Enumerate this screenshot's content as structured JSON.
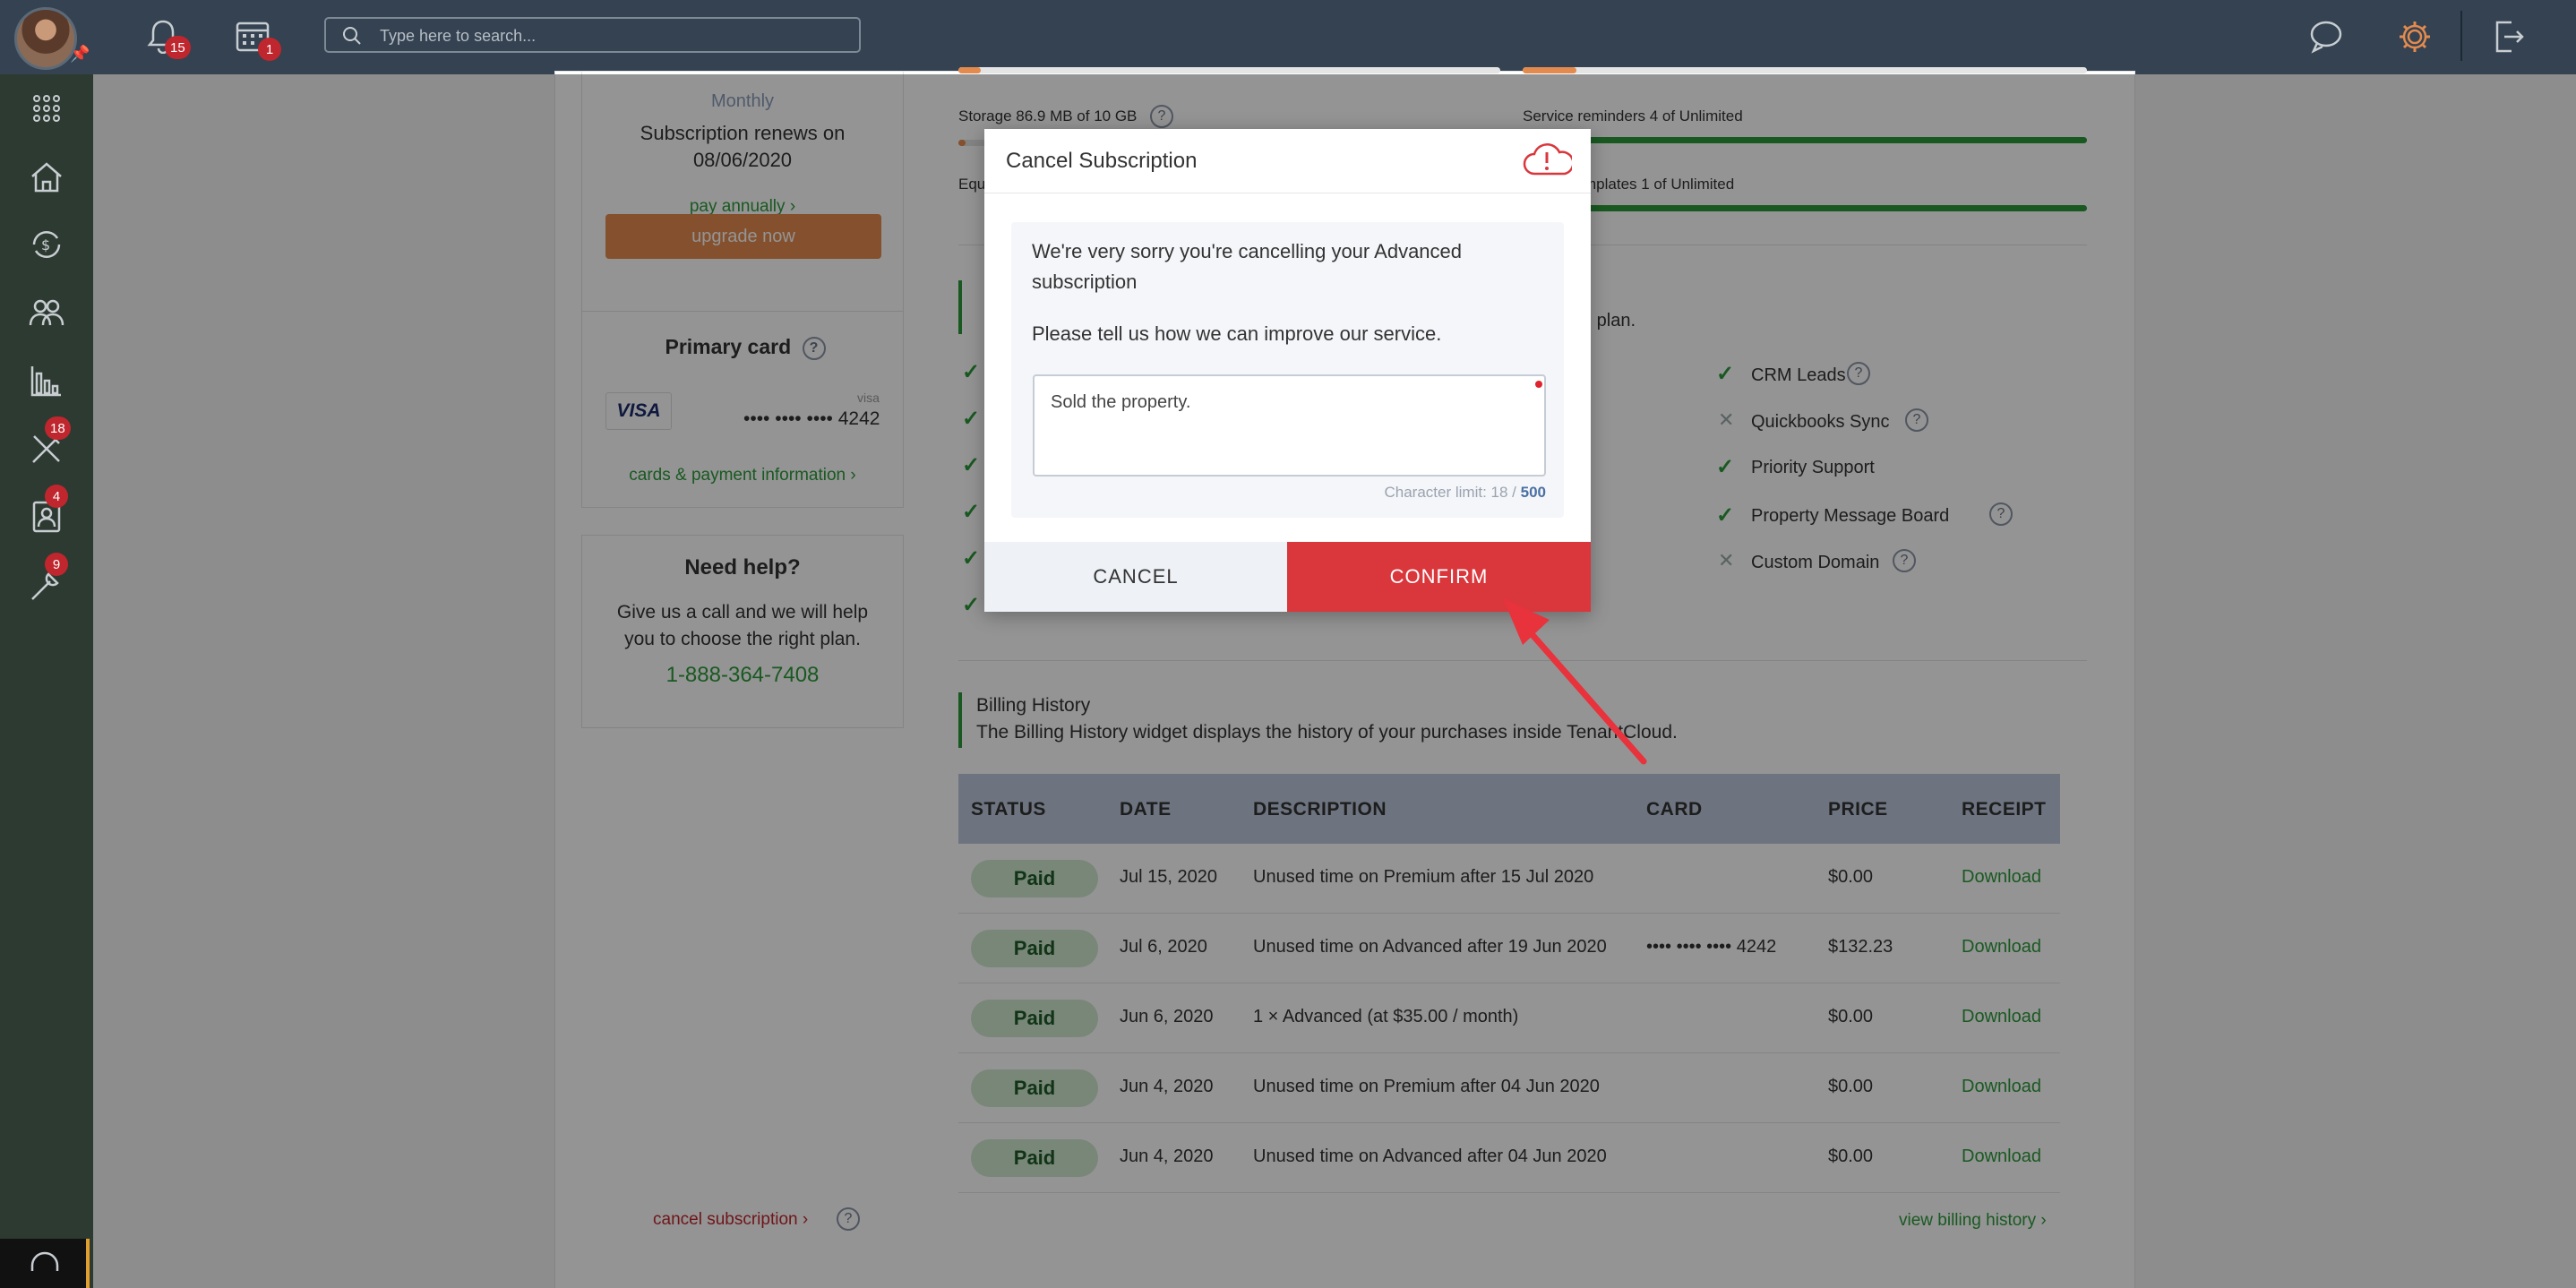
{
  "topbar": {
    "notifications_count": "15",
    "calendar_count": "1",
    "search_placeholder": "Type here to search..."
  },
  "sidebar": {
    "items": [
      {
        "icon": "apps-grid-icon"
      },
      {
        "icon": "properties-icon"
      },
      {
        "icon": "payments-icon"
      },
      {
        "icon": "contacts-icon"
      },
      {
        "icon": "reports-icon"
      },
      {
        "icon": "maintenance-icon",
        "badge": "18"
      },
      {
        "icon": "applications-icon",
        "badge": "4"
      },
      {
        "icon": "tools-icon",
        "badge": "9"
      }
    ]
  },
  "plan": {
    "period": "Monthly",
    "renews_label": "Subscription renews on",
    "renews_date": "08/06/2020",
    "pay_annually": "pay annually",
    "upgrade": "upgrade now"
  },
  "card": {
    "title": "Primary card",
    "brand": "VISA",
    "brand_small": "visa",
    "number": "•••• •••• •••• 4242",
    "link": "cards & payment information"
  },
  "help": {
    "title": "Need help?",
    "line1": "Give us a call and we will help",
    "line2": "you to choose the right plan.",
    "phone": "1-888-364-7408"
  },
  "cancel_link": "cancel subscription",
  "usage": {
    "storage": "Storage 86.9 MB of 10 GB",
    "service_reminders": "Service reminders 4 of Unlimited",
    "templates_partial": "mplates 1 of Unlimited",
    "equ_partial": "Equ",
    "plan_partial": "n plan."
  },
  "features": [
    {
      "label": "CRM Leads",
      "enabled": true
    },
    {
      "label": "Quickbooks Sync",
      "enabled": false
    },
    {
      "label": "Priority Support",
      "enabled": true
    },
    {
      "label": "Property Message Board",
      "enabled": true
    },
    {
      "label": "Custom Domain",
      "enabled": false
    }
  ],
  "billing": {
    "title": "Billing History",
    "subtitle": "The Billing History widget displays the history of your purchases inside TenantCloud.",
    "headers": [
      "STATUS",
      "DATE",
      "DESCRIPTION",
      "CARD",
      "PRICE",
      "RECEIPT"
    ],
    "rows": [
      {
        "status": "Paid",
        "date": "Jul 15, 2020",
        "description": "Unused time on Premium after 15 Jul 2020",
        "card": "",
        "price": "$0.00",
        "receipt": "Download"
      },
      {
        "status": "Paid",
        "date": "Jul 6, 2020",
        "description": "Unused time on Advanced after 19 Jun 2020",
        "card": "•••• •••• •••• 4242",
        "price": "$132.23",
        "receipt": "Download"
      },
      {
        "status": "Paid",
        "date": "Jun 6, 2020",
        "description": "1 × Advanced (at $35.00 / month)",
        "card": "",
        "price": "$0.00",
        "receipt": "Download"
      },
      {
        "status": "Paid",
        "date": "Jun 4, 2020",
        "description": "Unused time on Premium after 04 Jun 2020",
        "card": "",
        "price": "$0.00",
        "receipt": "Download"
      },
      {
        "status": "Paid",
        "date": "Jun 4, 2020",
        "description": "Unused time on Advanced after 04 Jun 2020",
        "card": "",
        "price": "$0.00",
        "receipt": "Download"
      }
    ],
    "view_link": "view billing history"
  },
  "modal": {
    "title": "Cancel Subscription",
    "msg_prefix": "We're very sorry you're cancelling your",
    "msg_plan": "Advanced",
    "msg_suffix": "subscription",
    "prompt": "Please tell us how we can improve our service.",
    "reason_value": "Sold the property.",
    "limit_label": "Character limit: 18 /",
    "limit_max": "500",
    "cancel": "CANCEL",
    "confirm": "CONFIRM"
  },
  "colors": {
    "topbar": "#344251",
    "sidebar": "#2d3a31",
    "accent_green": "#2c9a3a",
    "confirm_red": "#d9373c",
    "upgrade_orange": "#e38a4e",
    "badge_red": "#c0262d"
  }
}
